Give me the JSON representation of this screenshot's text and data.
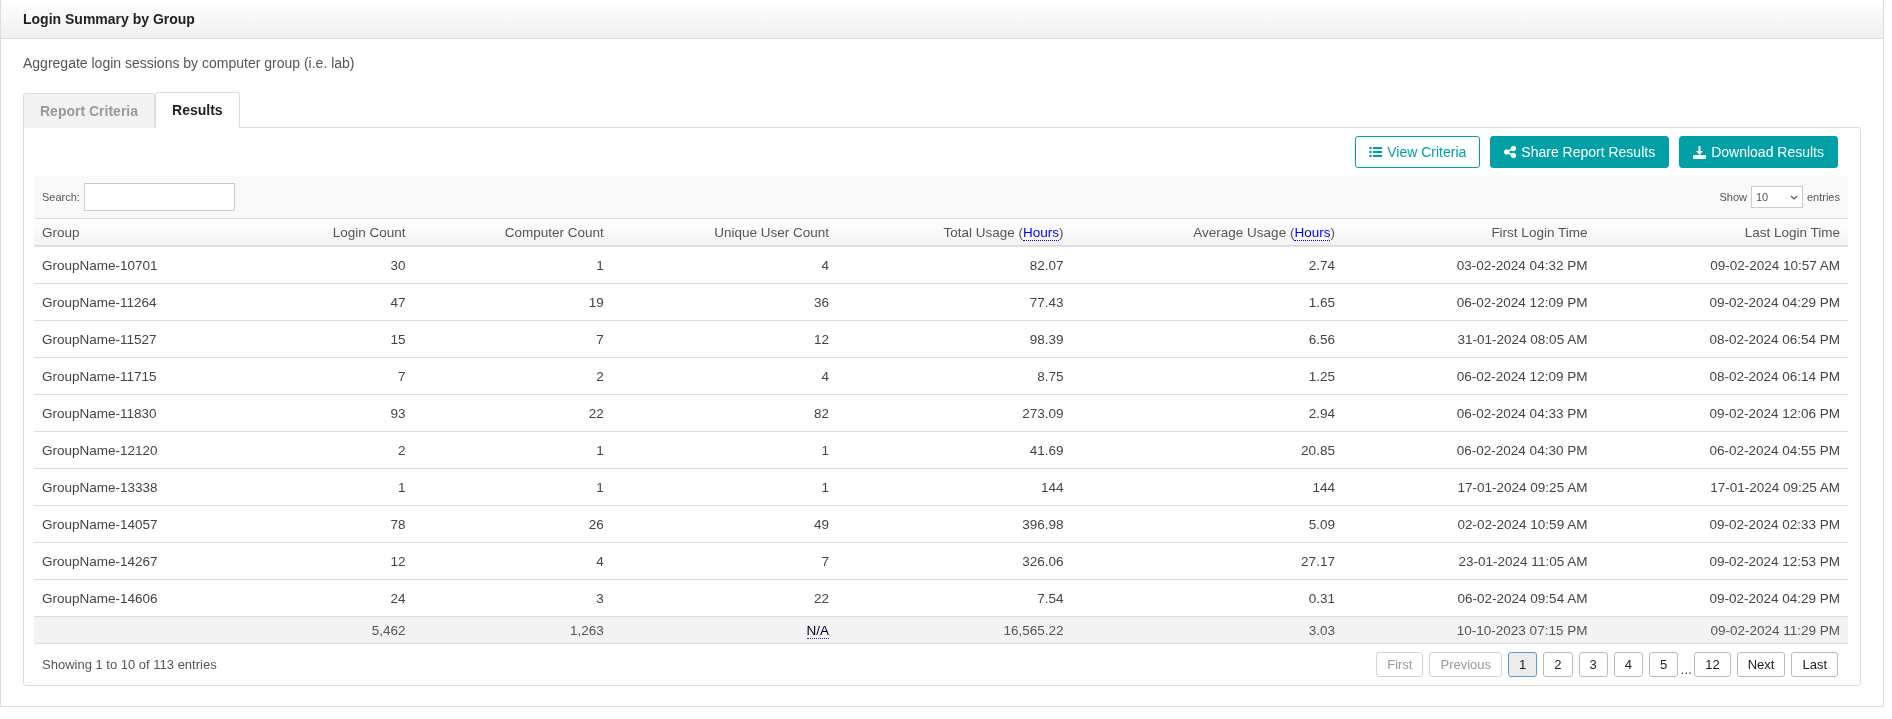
{
  "panel": {
    "title": "Login Summary by Group",
    "description": "Aggregate login sessions by computer group (i.e. lab)"
  },
  "tabs": [
    {
      "label": "Report Criteria",
      "selected": false
    },
    {
      "label": "Results",
      "selected": true
    }
  ],
  "actions": [
    {
      "kind": "outline",
      "label": "View Criteria"
    },
    {
      "kind": "solid",
      "label": "Share Report Results"
    },
    {
      "kind": "solid",
      "label": "Download Results"
    }
  ],
  "search": {
    "label": "Search:"
  },
  "length": {
    "before": "Show",
    "value": "10",
    "after": "entries"
  },
  "table": {
    "columns": [
      {
        "label": "Group"
      },
      {
        "label": "Login Count"
      },
      {
        "label": "Computer Count"
      },
      {
        "label": "Unique User Count"
      },
      {
        "label": "Total Usage (",
        "link": "Hours",
        "suffix": ")"
      },
      {
        "label": "Average Usage (",
        "link": "Hours",
        "suffix": ")"
      },
      {
        "label": "First Login Time"
      },
      {
        "label": "Last Login Time"
      }
    ],
    "rows": [
      [
        "GroupName-10701",
        "30",
        "1",
        "4",
        "82.07",
        "2.74",
        "03-02-2024 04:32 PM",
        "09-02-2024 10:57 AM"
      ],
      [
        "GroupName-11264",
        "47",
        "19",
        "36",
        "77.43",
        "1.65",
        "06-02-2024 12:09 PM",
        "09-02-2024 04:29 PM"
      ],
      [
        "GroupName-11527",
        "15",
        "7",
        "12",
        "98.39",
        "6.56",
        "31-01-2024 08:05 AM",
        "08-02-2024 06:54 PM"
      ],
      [
        "GroupName-11715",
        "7",
        "2",
        "4",
        "8.75",
        "1.25",
        "06-02-2024 12:09 PM",
        "08-02-2024 06:14 PM"
      ],
      [
        "GroupName-11830",
        "93",
        "22",
        "82",
        "273.09",
        "2.94",
        "06-02-2024 04:33 PM",
        "09-02-2024 12:06 PM"
      ],
      [
        "GroupName-12120",
        "2",
        "1",
        "1",
        "41.69",
        "20.85",
        "06-02-2024 04:30 PM",
        "06-02-2024 04:55 PM"
      ],
      [
        "GroupName-13338",
        "1",
        "1",
        "1",
        "144",
        "144",
        "17-01-2024 09:25 AM",
        "17-01-2024 09:25 AM"
      ],
      [
        "GroupName-14057",
        "78",
        "26",
        "49",
        "396.98",
        "5.09",
        "02-02-2024 10:59 AM",
        "09-02-2024 02:33 PM"
      ],
      [
        "GroupName-14267",
        "12",
        "4",
        "7",
        "326.06",
        "27.17",
        "23-01-2024 11:05 AM",
        "09-02-2024 12:53 PM"
      ],
      [
        "GroupName-14606",
        "24",
        "3",
        "22",
        "7.54",
        "0.31",
        "06-02-2024 09:54 AM",
        "09-02-2024 04:29 PM"
      ]
    ],
    "footer": [
      {
        "kind": "empty"
      },
      {
        "kind": "text",
        "text": "5,462"
      },
      {
        "kind": "text",
        "text": "1,263"
      },
      {
        "kind": "abbr",
        "text": "N/A"
      },
      {
        "kind": "text",
        "text": "16,565.22"
      },
      {
        "kind": "text",
        "text": "3.03"
      },
      {
        "kind": "text",
        "text": "10-10-2023 07:15 PM"
      },
      {
        "kind": "text",
        "text": "09-02-2024 11:29 PM"
      }
    ]
  },
  "info": "Showing 1 to 10 of 113 entries",
  "pagination": [
    {
      "label": "First",
      "kind": "nav",
      "disabled": true,
      "selected": false
    },
    {
      "label": "Previous",
      "kind": "nav",
      "disabled": true,
      "selected": false
    },
    {
      "label": "1",
      "kind": "page",
      "disabled": false,
      "selected": true
    },
    {
      "label": "2",
      "kind": "page",
      "disabled": false,
      "selected": false
    },
    {
      "label": "3",
      "kind": "page",
      "disabled": false,
      "selected": false
    },
    {
      "label": "4",
      "kind": "page",
      "disabled": false,
      "selected": false
    },
    {
      "label": "5",
      "kind": "page",
      "disabled": false,
      "selected": false
    },
    {
      "label": "…",
      "kind": "ellipsis"
    },
    {
      "label": "12",
      "kind": "page",
      "disabled": false,
      "selected": false
    },
    {
      "label": "Next",
      "kind": "nav",
      "disabled": false,
      "selected": false
    },
    {
      "label": "Last",
      "kind": "nav",
      "disabled": false,
      "selected": false
    }
  ]
}
